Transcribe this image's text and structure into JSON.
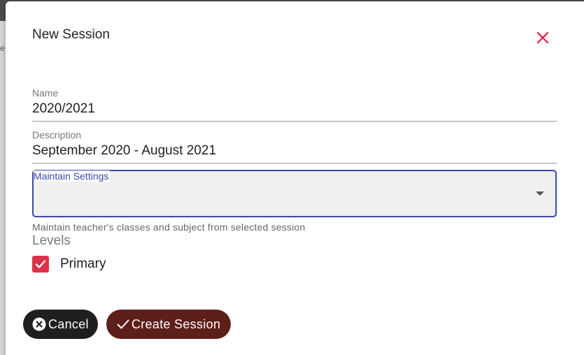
{
  "dialog": {
    "title": "New Session",
    "close_icon": "close-icon",
    "accent_color": "#e0314a"
  },
  "form": {
    "name": {
      "label": "Name",
      "value": "2020/2021"
    },
    "description": {
      "label": "Description",
      "value": "September 2020 - August 2021"
    },
    "maintain_settings": {
      "label": "Maintain Settings",
      "value": "",
      "helper": "Maintain teacher's classes and subject from selected session"
    },
    "levels": {
      "heading": "Levels",
      "options": [
        {
          "label": "Primary",
          "checked": true
        }
      ]
    }
  },
  "actions": {
    "cancel_label": "Cancel",
    "create_label": "Create Session"
  }
}
